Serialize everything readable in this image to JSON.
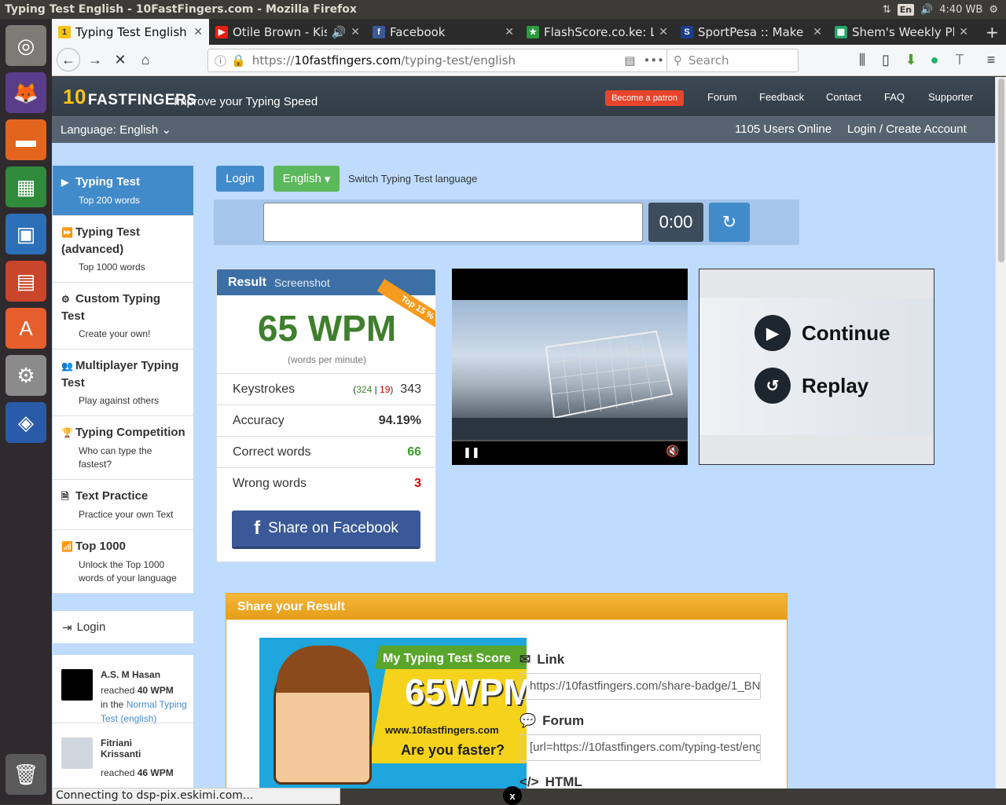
{
  "window": {
    "title": "Typing Test English - 10FastFingers.com - Mozilla Firefox",
    "keyboard": "En",
    "time": "4:40 WB"
  },
  "tabs": [
    {
      "label": "Typing Test English -",
      "icon": "10ff-icon",
      "active": true
    },
    {
      "label": "Otile Brown - Kisto",
      "icon": "youtube-icon",
      "active": false
    },
    {
      "label": "Facebook",
      "icon": "facebook-icon",
      "active": false
    },
    {
      "label": "FlashScore.co.ke: Li",
      "icon": "flashscore-icon",
      "active": false
    },
    {
      "label": "SportPesa :: Make it",
      "icon": "sportpesa-icon",
      "active": false
    },
    {
      "label": "Shem's Weekly Plan",
      "icon": "sheets-icon",
      "active": false
    }
  ],
  "nav": {
    "url_prefix": "https://",
    "url_domain": "10fastfingers.com",
    "url_path": "/typing-test/english",
    "search_placeholder": "Search"
  },
  "site": {
    "logo_num": "10",
    "logo_text": "FASTFINGERS",
    "tagline": "Improve your Typing Speed",
    "patron": "Become a patron",
    "links": [
      "Forum",
      "Feedback",
      "Contact",
      "FAQ",
      "Supporter"
    ],
    "language": "Language: English",
    "users_online": "1105 Users Online",
    "login_create": "Login / Create Account"
  },
  "sidebar": [
    {
      "title": "Typing Test",
      "sub": "Top 200 words"
    },
    {
      "title": "Typing Test (advanced)",
      "sub": "Top 1000 words"
    },
    {
      "title": "Custom Typing Test",
      "sub": "Create your own!"
    },
    {
      "title": "Multiplayer Typing Test",
      "sub": "Play against others"
    },
    {
      "title": "Typing Competition",
      "sub": "Who can type the fastest?"
    },
    {
      "title": "Text Practice",
      "sub": "Practice your own Text"
    },
    {
      "title": "Top 1000",
      "sub": "Unlock the Top 1000 words of your language"
    }
  ],
  "sidebar_login": "Login",
  "feed": [
    {
      "name": "A.S. M Hasan",
      "reached": "reached",
      "wpm": "40 WPM",
      "in": "in the",
      "link": "Normal Typing Test (english)"
    },
    {
      "name": "Fitriani Krissanti",
      "reached": "reached",
      "wpm": "46 WPM",
      "in": "",
      "link": ""
    }
  ],
  "controls": {
    "login": "Login",
    "language": "English",
    "switch": "Switch Typing Test language",
    "timer": "0:00"
  },
  "result": {
    "header": "Result",
    "screenshot": "Screenshot",
    "wpm": "65 WPM",
    "wpm_sub": "(words per minute)",
    "ribbon": "Top 15 %",
    "keystrokes_label": "Keystrokes",
    "keystrokes_correct": "324",
    "keystrokes_wrong": "19",
    "keystrokes_total": "343",
    "accuracy_label": "Accuracy",
    "accuracy": "94.19%",
    "correct_label": "Correct words",
    "correct": "66",
    "wrong_label": "Wrong words",
    "wrong": "3",
    "facebook": "Share on Facebook"
  },
  "ad": {
    "continue": "Continue",
    "replay": "Replay"
  },
  "share": {
    "header": "Share your Result",
    "badge_title": "My Typing Test Score",
    "badge_wpm": "65WPM",
    "badge_site": "www.10fastfingers.com",
    "badge_q": "Are you faster?",
    "link_label": "Link",
    "link_value": "https://10fastfingers.com/share-badge/1_BN",
    "forum_label": "Forum",
    "forum_value": "[url=https://10fastfingers.com/typing-test/eng",
    "html_label": "HTML"
  },
  "status": "Connecting to dsp-pix.eskimi.com..."
}
